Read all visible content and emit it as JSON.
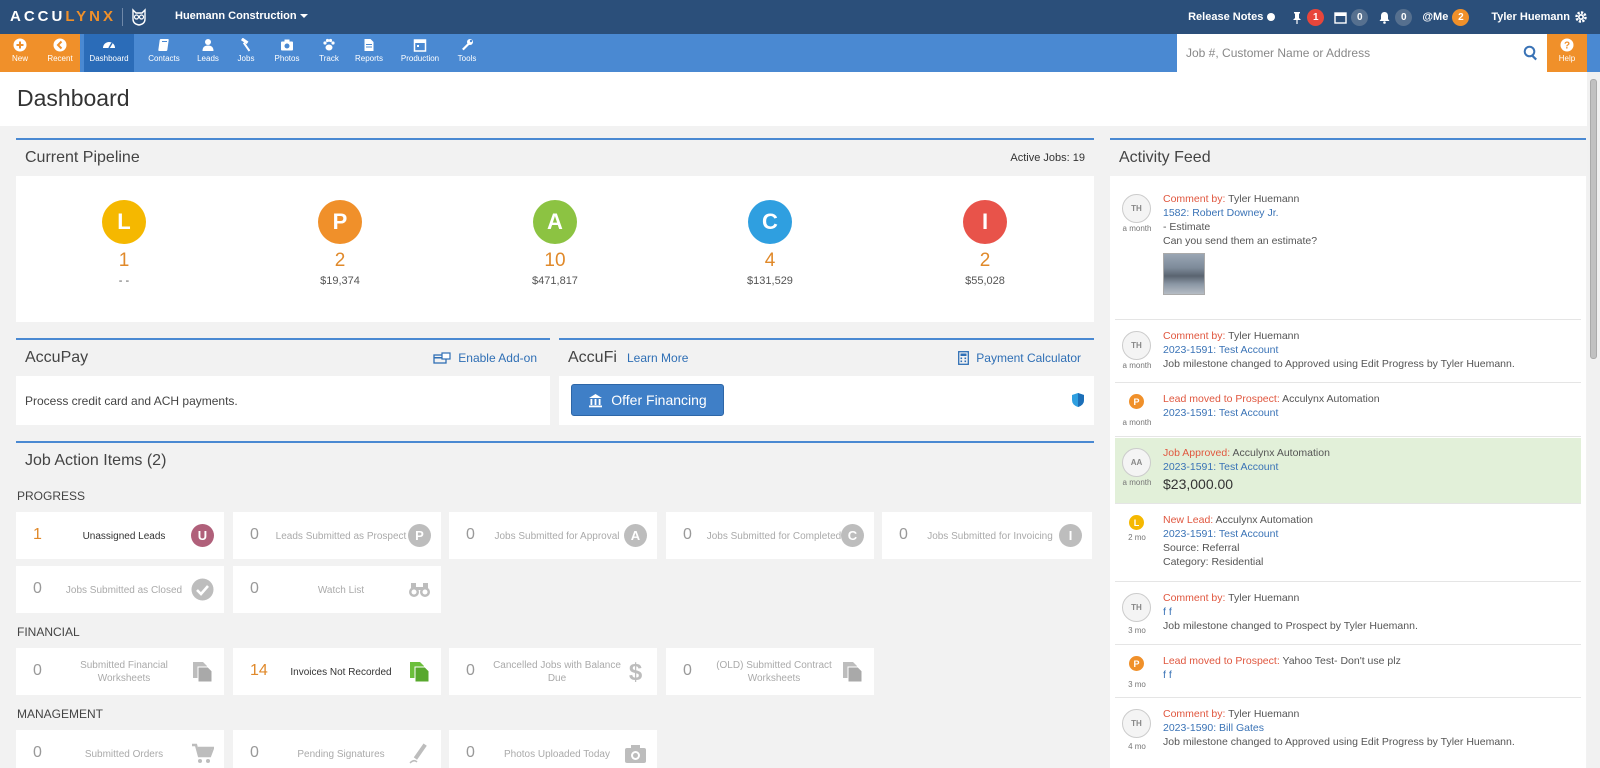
{
  "topbar": {
    "logo_main": "ACCU",
    "logo_accent": "LYNX",
    "company": "Huemann Construction",
    "release_notes": "Release Notes",
    "pin_count": "1",
    "calendar_count": "0",
    "bell_count": "0",
    "me_label": "@Me",
    "me_count": "2",
    "user_name": "Tyler Huemann"
  },
  "nav": {
    "new_label": "New",
    "recent_label": "Recent",
    "items": [
      {
        "label": "Dashboard",
        "icon": "dashboard-icon"
      },
      {
        "label": "Contacts",
        "icon": "contacts-icon"
      },
      {
        "label": "Leads",
        "icon": "leads-icon"
      },
      {
        "label": "Jobs",
        "icon": "jobs-icon"
      },
      {
        "label": "Photos",
        "icon": "camera-icon"
      },
      {
        "label": "Track",
        "icon": "paw-icon"
      },
      {
        "label": "Reports",
        "icon": "reports-icon"
      },
      {
        "label": "Production",
        "icon": "calendar-icon"
      },
      {
        "label": "Tools",
        "icon": "wrench-icon"
      }
    ],
    "search_placeholder": "Job #, Customer Name or Address",
    "help_label": "Help"
  },
  "page": {
    "title": "Dashboard"
  },
  "pipeline": {
    "title": "Current Pipeline",
    "active_jobs": "Active Jobs: 19",
    "stages": [
      {
        "letter": "L",
        "count": "1",
        "value": "- -",
        "color": "#f5b800"
      },
      {
        "letter": "P",
        "count": "2",
        "value": "$19,374",
        "color": "#f0902a"
      },
      {
        "letter": "A",
        "count": "10",
        "value": "$471,817",
        "color": "#8cc342"
      },
      {
        "letter": "C",
        "count": "4",
        "value": "$131,529",
        "color": "#2f9fe0"
      },
      {
        "letter": "I",
        "count": "2",
        "value": "$55,028",
        "color": "#e8534a"
      }
    ]
  },
  "accupay": {
    "title": "AccuPay",
    "enable_label": "Enable Add-on",
    "text": "Process credit card and ACH payments."
  },
  "accufi": {
    "title": "AccuFi",
    "learn_more": "Learn More",
    "calculator_label": "Payment Calculator",
    "offer_label": "Offer Financing"
  },
  "job_actions": {
    "title": "Job Action Items (2)",
    "progress_label": "PROGRESS",
    "financial_label": "FINANCIAL",
    "management_label": "MANAGEMENT",
    "progress": [
      {
        "count": "1",
        "label": "Unassigned Leads",
        "letter": "U",
        "color": "#b0607a"
      },
      {
        "count": "0",
        "label": "Leads Submitted as Prospect",
        "letter": "P",
        "color": "#bdbdbd"
      },
      {
        "count": "0",
        "label": "Jobs Submitted for Approval",
        "letter": "A",
        "color": "#bdbdbd"
      },
      {
        "count": "0",
        "label": "Jobs Submitted for Completed",
        "letter": "C",
        "color": "#bdbdbd"
      },
      {
        "count": "0",
        "label": "Jobs Submitted for Invoicing",
        "letter": "I",
        "color": "#bdbdbd"
      },
      {
        "count": "0",
        "label": "Jobs Submitted as Closed",
        "icon": "checkmark-icon"
      },
      {
        "count": "0",
        "label": "Watch List",
        "icon": "binoculars-icon"
      }
    ],
    "financial": [
      {
        "count": "0",
        "label": "Submitted Financial Worksheets",
        "icon": "documents-icon"
      },
      {
        "count": "14",
        "label": "Invoices Not Recorded",
        "icon": "documents-icon",
        "accent": "#6cbf3c"
      },
      {
        "count": "0",
        "label": "Cancelled Jobs with Balance Due",
        "icon": "dollar-icon"
      },
      {
        "count": "0",
        "label": "(OLD) Submitted Contract Worksheets",
        "icon": "documents-icon"
      }
    ],
    "management": [
      {
        "count": "0",
        "label": "Submitted Orders",
        "icon": "cart-icon"
      },
      {
        "count": "0",
        "label": "Pending Signatures",
        "icon": "pen-icon"
      },
      {
        "count": "0",
        "label": "Photos Uploaded Today",
        "icon": "camera-icon"
      }
    ]
  },
  "feed": {
    "title": "Activity Feed",
    "items": [
      {
        "avatar": "TH",
        "time": "a month",
        "heading": "Comment by:",
        "actor": " Tyler Huemann",
        "link": "1582: Robert Downey Jr.",
        "lines": [
          "- Estimate",
          "Can you send them an estimate?"
        ]
      },
      {
        "avatar": "TH",
        "time": "a month",
        "heading": "Comment by:",
        "actor": " Tyler Huemann",
        "link": "2023-1591: Test Account",
        "lines": [
          "Job milestone changed to Approved using Edit Progress by Tyler Huemann."
        ]
      },
      {
        "avatar": "P",
        "time": "a month",
        "heading": "Lead moved to Prospect:",
        "actor": " Acculynx Automation",
        "link": "2023-1591: Test Account",
        "lines": []
      },
      {
        "avatar": "AA",
        "time": "a month",
        "heading": "Job Approved:",
        "actor": " Acculynx Automation",
        "link": "2023-1591: Test Account",
        "amount": "$23,000.00"
      },
      {
        "avatar": "L",
        "time": "2 mo",
        "heading": "New Lead:",
        "actor": " Acculynx Automation",
        "link": "2023-1591: Test Account",
        "lines": [
          "Source: Referral",
          "Category: Residential"
        ]
      },
      {
        "avatar": "TH",
        "time": "3 mo",
        "heading": "Comment by:",
        "actor": " Tyler Huemann",
        "link": "f f",
        "lines": [
          "Job milestone changed to Prospect by Tyler Huemann."
        ]
      },
      {
        "avatar": "P",
        "time": "3 mo",
        "heading": "Lead moved to Prospect:",
        "actor": " Yahoo Test- Don't use plz",
        "link": "f f",
        "lines": []
      },
      {
        "avatar": "TH",
        "time": "4 mo",
        "heading": "Comment by:",
        "actor": " Tyler Huemann",
        "link": "2023-1590: Bill Gates",
        "lines": [
          "Job milestone changed to Approved using Edit Progress by Tyler Huemann."
        ]
      }
    ]
  }
}
